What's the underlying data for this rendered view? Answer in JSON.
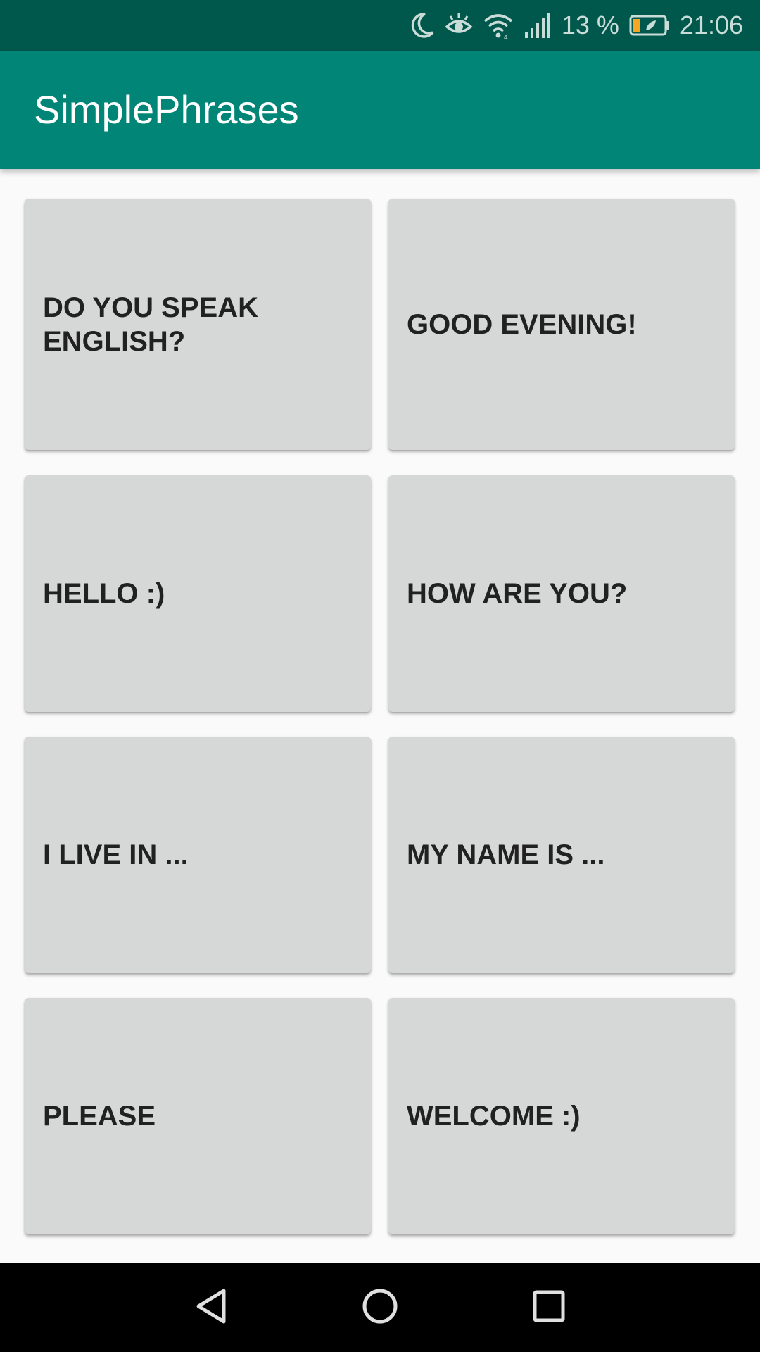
{
  "status_bar": {
    "battery_percent": "13 %",
    "time": "21:06",
    "icons": [
      "moon-icon",
      "eye-comfort-icon",
      "wifi-icon",
      "signal-icon",
      "battery-icon"
    ],
    "colors": {
      "background": "#00574b",
      "battery_fill": "#f5a623"
    }
  },
  "app_bar": {
    "title": "SimplePhrases",
    "color": "#008577"
  },
  "phrases": [
    {
      "label": "DO YOU SPEAK ENGLISH?"
    },
    {
      "label": "GOOD EVENING!"
    },
    {
      "label": "HELLO :)"
    },
    {
      "label": "HOW ARE YOU?"
    },
    {
      "label": "I LIVE IN ..."
    },
    {
      "label": "MY NAME IS ..."
    },
    {
      "label": "PLEASE"
    },
    {
      "label": "WELCOME :)"
    }
  ],
  "nav_bar": {
    "buttons": [
      "back-icon",
      "home-icon",
      "recents-icon"
    ]
  }
}
